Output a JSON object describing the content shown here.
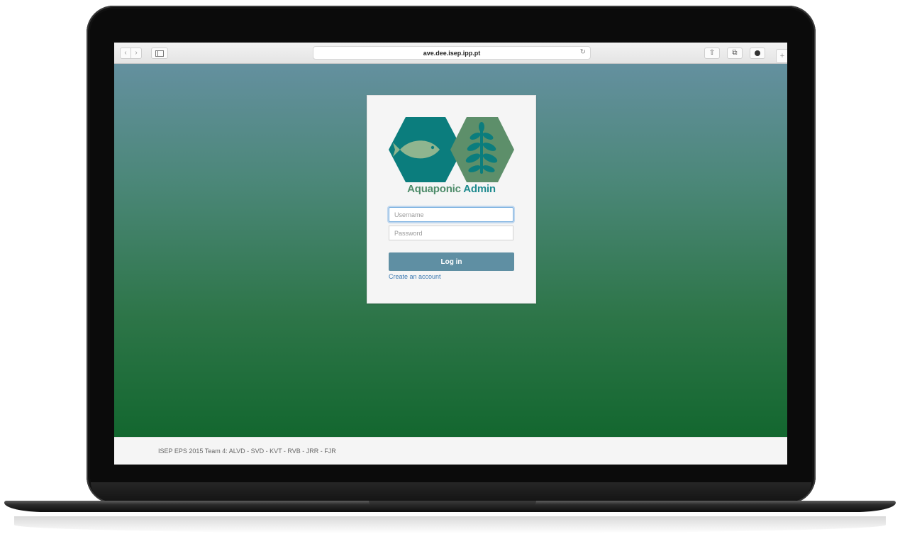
{
  "browser": {
    "back_icon": "chevron-left-icon",
    "forward_icon": "chevron-right-icon",
    "sidebar_icon": "sidebar-icon",
    "url": "ave.dee.isep.ipp.pt",
    "reload_icon": "reload-icon",
    "share_icon": "share-icon",
    "tabs_icon": "tabs-icon",
    "extension_icon": "extension-icon",
    "new_tab_icon": "plus-icon"
  },
  "login": {
    "logo": {
      "name": "aquaponic-logo",
      "fish_color": "#0b7d7d",
      "plant_color": "#5d8f6a"
    },
    "brand_part1": "Aquaponic",
    "brand_part2": "Admin",
    "username_placeholder": "Username",
    "username_value": "",
    "password_placeholder": "Password",
    "password_value": "",
    "login_label": "Log in",
    "create_account_label": "Create an account"
  },
  "footer": {
    "text": "ISEP EPS 2015 Team 4: ALVD - SVD - KVT - RVB - JRR - FJR"
  },
  "colors": {
    "gradient_top": "#64909f",
    "gradient_bottom": "#13672f",
    "login_button": "#5f8fa3",
    "link": "#3a78b0"
  }
}
